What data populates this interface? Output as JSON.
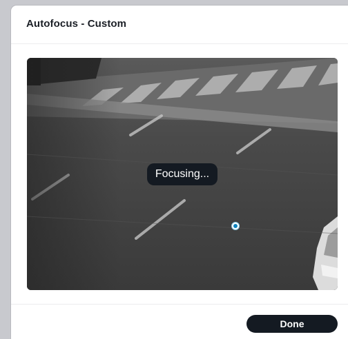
{
  "dialog": {
    "title": "Autofocus - Custom"
  },
  "video": {
    "status_label": "Focusing...",
    "focus_point_icon": "focus-point-marker",
    "focus_point_color": "#0c84bf"
  },
  "footer": {
    "done_label": "Done"
  },
  "colors": {
    "dark_ui": "#141a22",
    "background": "#c8c9ce"
  }
}
